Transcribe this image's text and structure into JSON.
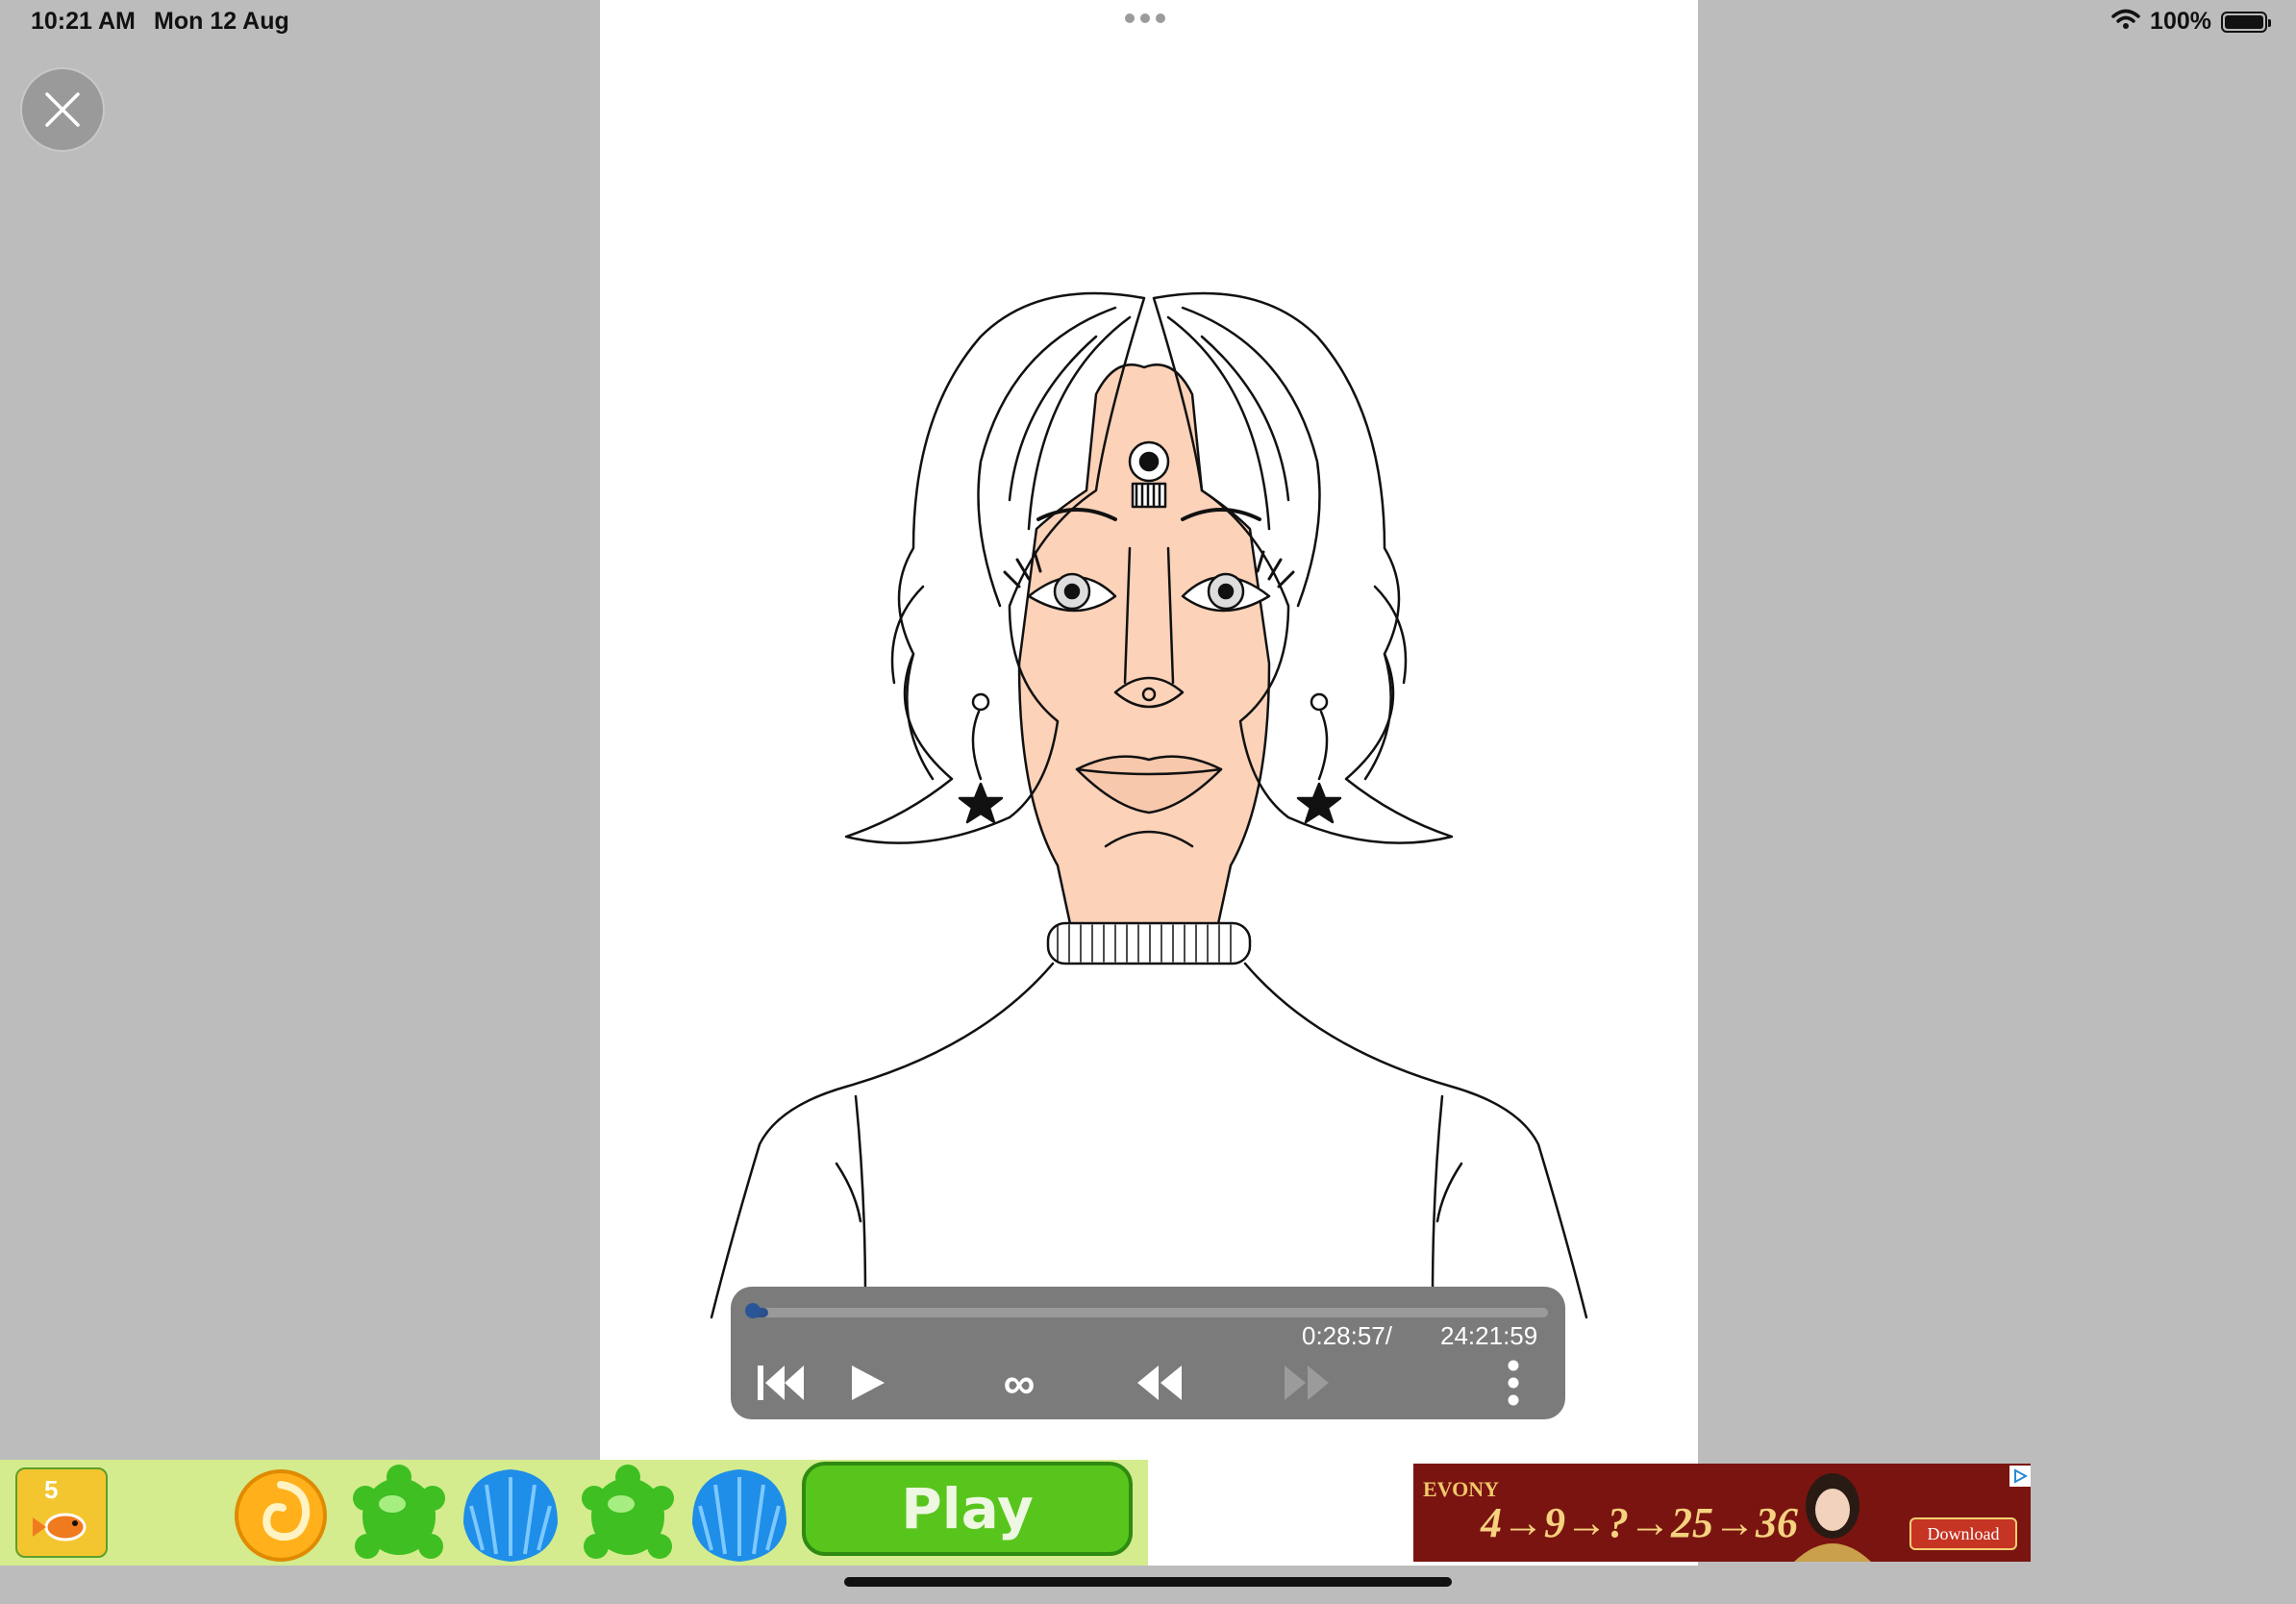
{
  "status_bar": {
    "time": "10:21 AM",
    "date": "Mon 12 Aug",
    "battery": "100%",
    "battery_level": 1.0
  },
  "canvas": {
    "more_menu_icon": "more-dots-icon"
  },
  "player": {
    "current_time": "0:28:57/",
    "total_time": "24:21:59",
    "progress": 0.02,
    "loop_glyph": "∞"
  },
  "ads": {
    "left": {
      "level_number": "5",
      "play_label": "Play"
    },
    "right": {
      "brand": "EVONY",
      "number_chain": "4→9→?→25→36",
      "download_label": "Download"
    }
  },
  "colors": {
    "skin": "#fcd2b8",
    "background": "#bcbcbc",
    "canvas": "#ffffff",
    "player": "#7b7b7b",
    "progress": "#2b4f8a"
  }
}
